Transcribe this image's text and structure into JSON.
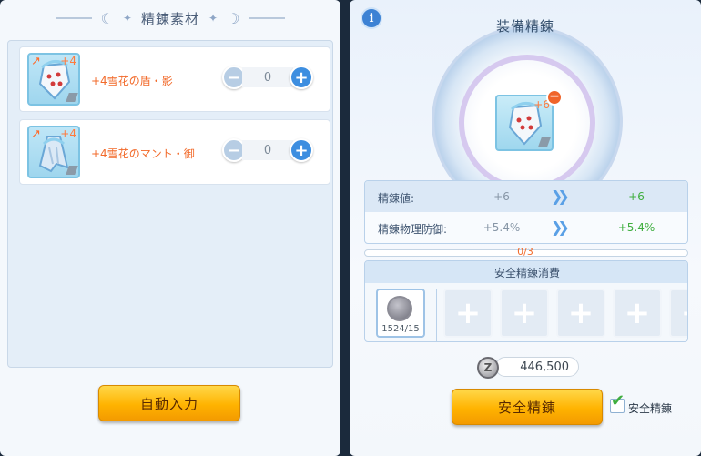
{
  "left_panel": {
    "title": "精錬素材",
    "materials": [
      {
        "name": "+4雪花の盾・影",
        "level": "+4",
        "quantity": "0"
      },
      {
        "name": "+4雪花のマント・御",
        "level": "+4",
        "quantity": "0"
      }
    ],
    "auto_input_label": "自動入力"
  },
  "right_panel": {
    "info_label": "i",
    "title": "装備精錬",
    "equipment_level": "+6",
    "stats": [
      {
        "label": "精錬値:",
        "current": "+6",
        "next": "+6"
      },
      {
        "label": "精錬物理防御:",
        "current": "+5.4%",
        "next": "+5.4%"
      }
    ],
    "progress_text": "0/3",
    "safe_cost": {
      "title": "安全精錬消費",
      "item_count": "1524/15"
    },
    "zeny": "446,500",
    "safe_refine_button": "安全精錬",
    "safe_refine_checkbox": {
      "label": "安全精錬",
      "checked": true
    }
  },
  "colors": {
    "accent_orange": "#f26a2a",
    "stat_green": "#3fae3f",
    "button_gold": "#ffb300",
    "plus_blue": "#3d8ee0"
  }
}
